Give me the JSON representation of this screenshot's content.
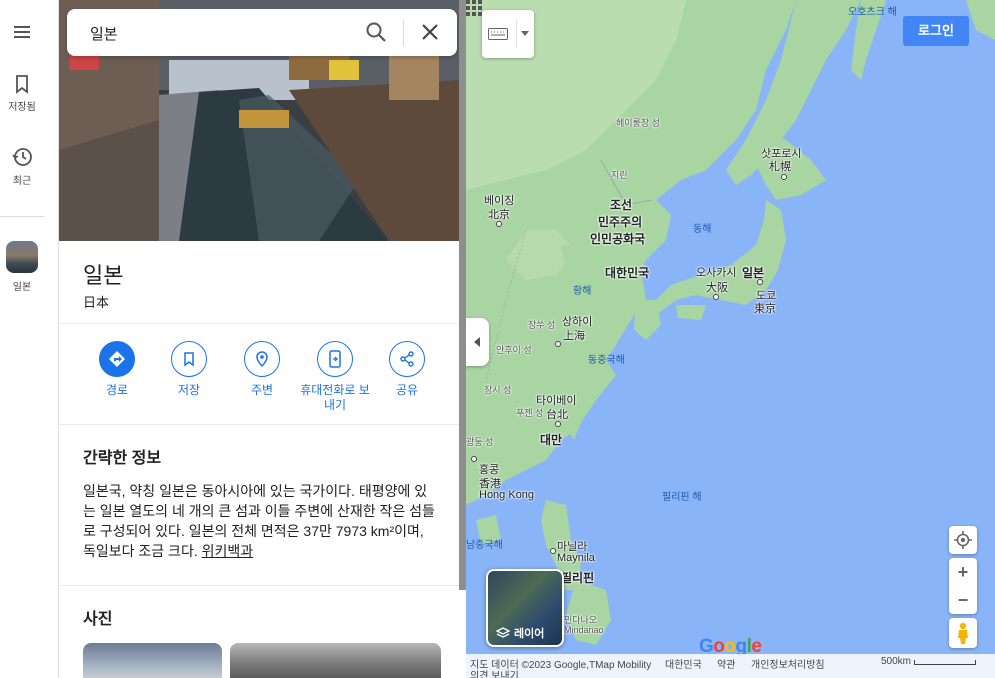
{
  "rail": {
    "menu_icon": "menu-icon",
    "saved": "저장됨",
    "recent": "최근",
    "place": "일본"
  },
  "search": {
    "value": "일본"
  },
  "place": {
    "title": "일본",
    "subtitle": "日本"
  },
  "actions": [
    {
      "label": "경로",
      "icon": "directions-icon"
    },
    {
      "label": "저장",
      "icon": "bookmark-icon"
    },
    {
      "label": "주변",
      "icon": "nearby-icon"
    },
    {
      "label": "휴대전화로 보내기",
      "icon": "send-to-phone-icon"
    },
    {
      "label": "공유",
      "icon": "share-icon"
    }
  ],
  "info": {
    "heading": "간략한 정보",
    "body": "일본국, 약칭 일본은 동아시아에 있는 국가이다. 태평양에 있는 일본 열도의 네 개의 큰 섬과 이들 주변에 산재한 작은 섬들로 구성되어 있다. 일본의 전체 면적은 37만 7973 km²이며, 독일보다 조금 크다.",
    "link": "위키백과"
  },
  "photos": {
    "heading": "사진"
  },
  "map": {
    "login": "로그인",
    "layers": "레이어",
    "labels": {
      "okhotsk": "오호츠크 해",
      "heilongjiang": "헤이룽장 성",
      "jilin": "지린",
      "sapporo": "삿포로시",
      "sapporo_ja": "札幌",
      "beijing": "베이징",
      "beijing_cn": "北京",
      "nk1": "조선",
      "nk2": "민주주의",
      "nk3": "인민공화국",
      "east_sea": "동해",
      "korea": "대한민국",
      "osaka": "오사카시",
      "osaka_ja": "大阪",
      "japan": "일본",
      "tokyo": "도쿄",
      "tokyo_ja": "東京",
      "yellow_sea": "황해",
      "jiangsu": "장쑤 성",
      "shanghai": "상하이",
      "shanghai_cn": "上海",
      "anhui": "안후이 성",
      "ecs": "동중국해",
      "jiangxi": "장시 성",
      "fujian": "푸젠 성",
      "taipei": "타이베이",
      "taipei_cn": "台北",
      "taiwan": "대만",
      "guangdong": "광둥 성",
      "hk": "홍콩",
      "hk_cn": "香港",
      "hk_en": "Hong Kong",
      "ph_sea": "필리핀 해",
      "scs": "남중국해",
      "manila": "마닐라",
      "manila_en": "Maynila",
      "philippines": "필리핀",
      "mindanao": "민다나오",
      "mindanao_en": "Mindanao"
    },
    "footer": {
      "data": "지도 데이터 ©2023 Google,TMap Mobility",
      "region": "대한민국",
      "terms": "약관",
      "privacy": "개인정보처리방침",
      "feedback": "의견 보내기",
      "scale": "500km"
    },
    "google": "Google"
  }
}
